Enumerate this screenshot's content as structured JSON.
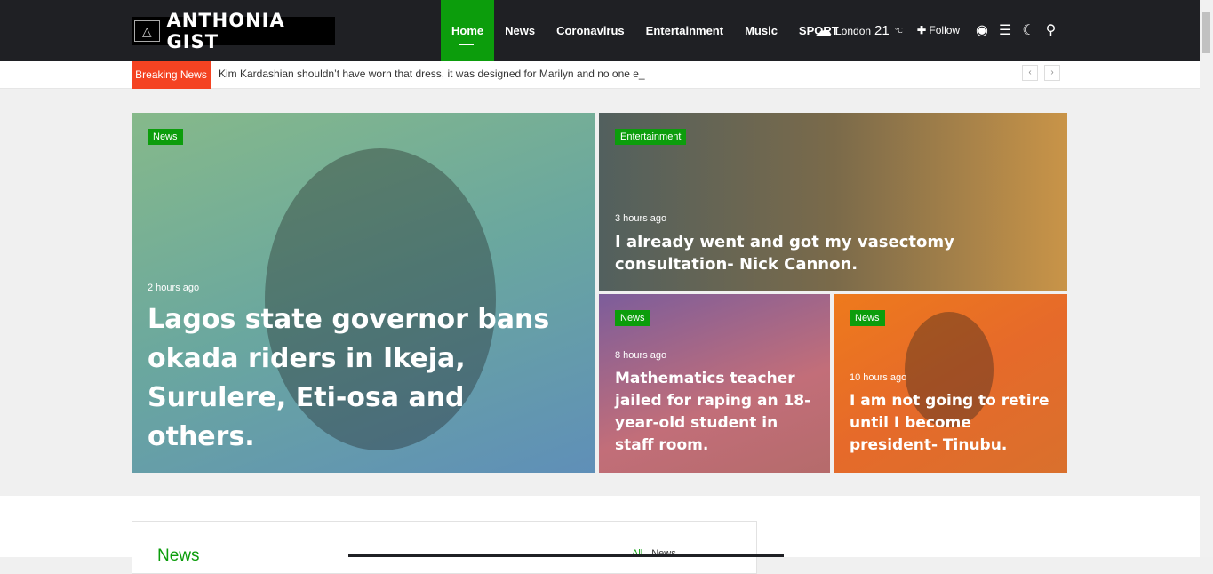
{
  "header": {
    "logo": "ANTHONIA GIST",
    "nav": [
      {
        "label": "Home",
        "active": true
      },
      {
        "label": "News"
      },
      {
        "label": "Coronavirus"
      },
      {
        "label": "Entertainment"
      },
      {
        "label": "Music"
      },
      {
        "label": "SPORT"
      }
    ],
    "weather": {
      "city": "London",
      "temp": "21",
      "unit": "℃",
      "icon": "cloud-sun-icon"
    },
    "follow": "Follow"
  },
  "ticker": {
    "label": "Breaking News",
    "text": "Kim Kardashian shouldn’t have worn that dress, it was designed for Marilyn and no one e_"
  },
  "featured": [
    {
      "category": "News",
      "time": "2 hours ago",
      "title": "Lagos state governor bans okada riders in Ikeja, Surulere, Eti-osa and others."
    },
    {
      "category": "Entertainment",
      "time": "3 hours ago",
      "title": "I already went and got my vasectomy consultation- Nick Cannon."
    },
    {
      "category": "News",
      "time": "8 hours ago",
      "title": "Mathematics teacher jailed for raping an 18-year-old student in staff room."
    },
    {
      "category": "News",
      "time": "10 hours ago",
      "title": "I am not going to retire until I become president- Tinubu."
    }
  ],
  "section": {
    "title": "News",
    "filters": [
      "All",
      "News"
    ]
  },
  "colors": {
    "accent": "#0c9d0c",
    "breaking": "#f44322",
    "topbar": "#1f2024"
  }
}
